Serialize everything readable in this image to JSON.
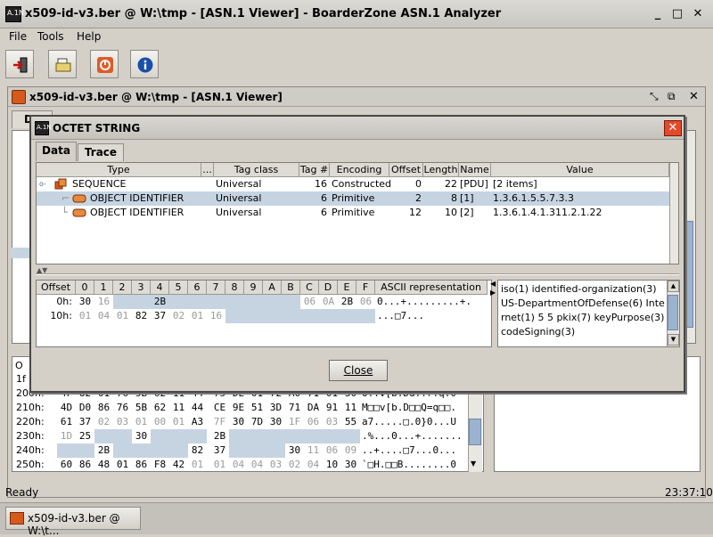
{
  "window": {
    "title": "x509-id-v3.ber @ W:\\tmp - [ASN.1 Viewer] - BoarderZone ASN.1 Analyzer",
    "app_icon_text": "A.1N"
  },
  "menu": {
    "items": [
      "File",
      "Tools",
      "Help"
    ],
    "mnemonics": [
      "F",
      "T",
      "H"
    ]
  },
  "toolbar": {
    "buttons": [
      "exit-icon",
      "open-folder-icon",
      "power-icon",
      "info-icon"
    ]
  },
  "inner_frame": {
    "title": "x509-id-v3.ber @ W:\\tmp - [ASN.1 Viewer]",
    "tab_label": "Da"
  },
  "background_hex": {
    "rows": [
      {
        "offset": "1f",
        "bytes": [
          "",
          "",
          "",
          "",
          "",
          "",
          "",
          "",
          "",
          "",
          "",
          "",
          "",
          "",
          "",
          ""
        ],
        "ascii": ""
      },
      {
        "offset": "200h:",
        "bytes": [
          "4F",
          "82",
          "01",
          "76",
          "5B",
          "62",
          "11",
          "44",
          "75",
          "DE",
          "01",
          "72",
          "A0",
          "71",
          "01",
          "30"
        ],
        "ascii": "O..v[b.Du..r.q.0"
      },
      {
        "offset": "210h:",
        "bytes": [
          "4D",
          "D0",
          "86",
          "76",
          "5B",
          "62",
          "11",
          "44",
          "CE",
          "9E",
          "51",
          "3D",
          "71",
          "DA",
          "91",
          "11"
        ],
        "ascii": "M□□v[b.D□□Q=q□□."
      },
      {
        "offset": "220h:",
        "bytes": [
          "61",
          "37",
          "02",
          "03",
          "01",
          "00",
          "01",
          "A3",
          "7F",
          "30",
          "7D",
          "30",
          "1F",
          "06",
          "03",
          "55"
        ],
        "ascii": "a7.....□.0}0...U"
      },
      {
        "offset": "230h:",
        "bytes": [
          "1D",
          "25",
          "",
          "",
          "30",
          "",
          "",
          "",
          "2B",
          "",
          "",
          "",
          "",
          "",
          "",
          ""
        ],
        "ascii": ".%...0...+......."
      },
      {
        "offset": "240h:",
        "bytes": [
          "",
          "",
          "2B",
          "",
          "",
          "",
          "",
          "82",
          "37",
          "",
          "",
          "",
          "30",
          "11",
          "06",
          "09"
        ],
        "ascii": "..+....□7...0..."
      },
      {
        "offset": "250h:",
        "bytes": [
          "60",
          "86",
          "48",
          "01",
          "86",
          "F8",
          "42",
          "01",
          "01",
          "04",
          "04",
          "03",
          "02",
          "04",
          "10",
          "30"
        ],
        "ascii": "`□H.□□B........0"
      }
    ],
    "header_offset": "O"
  },
  "dialog": {
    "title": "OCTET STRING",
    "tabs": [
      {
        "label": "Data",
        "mnemonic": "D"
      },
      {
        "label": "Trace",
        "mnemonic": "T"
      }
    ],
    "table": {
      "columns": [
        "Type",
        "...",
        "Tag class",
        "Tag #",
        "Encoding",
        "Offset",
        "Length",
        "Name",
        "Value"
      ],
      "rows": [
        {
          "type": "SEQUENCE",
          "tag_class": "Universal",
          "tag_num": "16",
          "encoding": "Constructed",
          "offset": "0",
          "length": "22",
          "name": "[PDU]",
          "value": "[2 items]"
        },
        {
          "type": "OBJECT IDENTIFIER",
          "tag_class": "Universal",
          "tag_num": "6",
          "encoding": "Primitive",
          "offset": "2",
          "length": "8",
          "name": "[1]",
          "value": "1.3.6.1.5.5.7.3.3"
        },
        {
          "type": "OBJECT IDENTIFIER",
          "tag_class": "Universal",
          "tag_num": "6",
          "encoding": "Primitive",
          "offset": "12",
          "length": "10",
          "name": "[2]",
          "value": "1.3.6.1.4.1.311.2.1.22"
        }
      ]
    },
    "hex": {
      "headers": [
        "Offset",
        "0",
        "1",
        "2",
        "3",
        "4",
        "5",
        "6",
        "7",
        "8",
        "9",
        "A",
        "B",
        "C",
        "D",
        "E",
        "F",
        "ASCII representation"
      ],
      "rows": [
        {
          "offset": "0h:",
          "bytes": [
            "30",
            "16",
            "",
            "",
            "2B",
            "",
            "",
            "",
            "",
            "",
            "",
            "",
            "06",
            "0A",
            "2B",
            "06"
          ],
          "ascii": "0...+.........+."
        },
        {
          "offset": "10h:",
          "bytes": [
            "01",
            "04",
            "01",
            "82",
            "37",
            "02",
            "01",
            "16",
            "",
            "",
            "",
            "",
            "",
            "",
            "",
            ""
          ],
          "ascii": "...□7..."
        }
      ]
    },
    "value_text": "iso(1) identified-organization(3) US-DepartmentOfDefense(6) Internet(1) 5 5 pkix(7) keyPurpose(3) codeSigning(3)",
    "close_label": "Close",
    "close_mnemonic": "C"
  },
  "status": {
    "text": "Ready",
    "time": "23:37:10"
  },
  "taskbar": {
    "item_label": "x509-id-v3.ber @ W:\\t..."
  }
}
